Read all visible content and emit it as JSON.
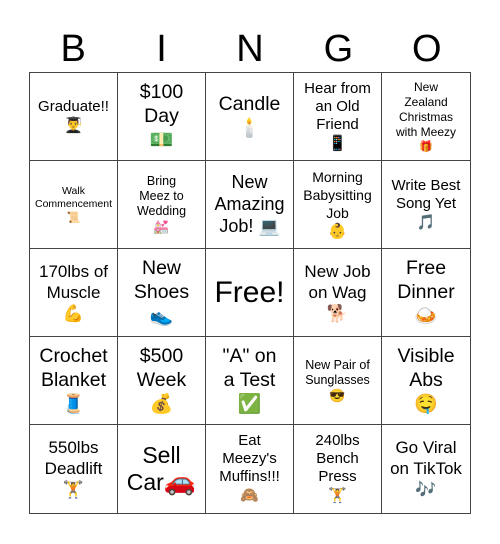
{
  "header": [
    "B",
    "I",
    "N",
    "G",
    "O"
  ],
  "cells": [
    {
      "text": "Graduate!!",
      "emoji": "👨‍🎓",
      "icon": "graduate-icon"
    },
    {
      "text": "$100\nDay",
      "emoji": "💵",
      "icon": "dollar-bill-icon"
    },
    {
      "text": "Candle",
      "emoji": "🕯️",
      "icon": "candle-icon"
    },
    {
      "text": "Hear from\nan Old\nFriend",
      "emoji": "📱",
      "icon": "mobile-phone-icon"
    },
    {
      "text": "New\nZealand\nChristmas\nwith Meezy",
      "emoji": "🎁",
      "icon": "gift-icon"
    },
    {
      "text": "Walk\nCommencement",
      "emoji": "📜",
      "icon": "scroll-icon"
    },
    {
      "text": "Bring\nMeez to\nWedding",
      "emoji": "💒",
      "icon": "wedding-chapel-icon"
    },
    {
      "text": "New\nAmazing\nJob!",
      "emoji": "💻",
      "icon": "laptop-icon"
    },
    {
      "text": "Morning\nBabysitting\nJob",
      "emoji": "👶",
      "icon": "baby-icon"
    },
    {
      "text": "Write Best\nSong Yet",
      "emoji": "🎵",
      "icon": "music-note-icon"
    },
    {
      "text": "170lbs of\nMuscle",
      "emoji": "💪",
      "icon": "flexed-biceps-icon"
    },
    {
      "text": "New\nShoes",
      "emoji": "👟",
      "icon": "sneaker-icon"
    },
    {
      "text": "Free!",
      "emoji": "",
      "icon": ""
    },
    {
      "text": "New Job\non Wag",
      "emoji": "🐕",
      "icon": "dog-icon"
    },
    {
      "text": "Free\nDinner",
      "emoji": "🍛",
      "icon": "dinner-plate-icon"
    },
    {
      "text": "Crochet\nBlanket",
      "emoji": "🧵",
      "icon": "thread-spool-icon"
    },
    {
      "text": "$500\nWeek",
      "emoji": "💰",
      "icon": "money-bag-icon"
    },
    {
      "text": "\"A\" on\na Test",
      "emoji": "✅",
      "icon": "check-mark-icon"
    },
    {
      "text": "New Pair of\nSunglasses",
      "emoji": "😎",
      "icon": "sunglasses-face-icon"
    },
    {
      "text": "Visible\nAbs",
      "emoji": "🤤",
      "icon": "drooling-face-icon"
    },
    {
      "text": "550lbs\nDeadlift",
      "emoji": "🏋️",
      "icon": "weightlifter-icon"
    },
    {
      "text": "Sell\nCar",
      "emoji": "🚗",
      "icon": "car-icon"
    },
    {
      "text": "Eat\nMeezy's\nMuffins!!!",
      "emoji": "🙈",
      "icon": "see-no-evil-monkey-icon"
    },
    {
      "text": "240lbs\nBench\nPress",
      "emoji": "🏋️",
      "icon": "weightlifter-icon"
    },
    {
      "text": "Go Viral\non TikTok",
      "emoji": "🎶",
      "icon": "music-notes-icon"
    }
  ]
}
